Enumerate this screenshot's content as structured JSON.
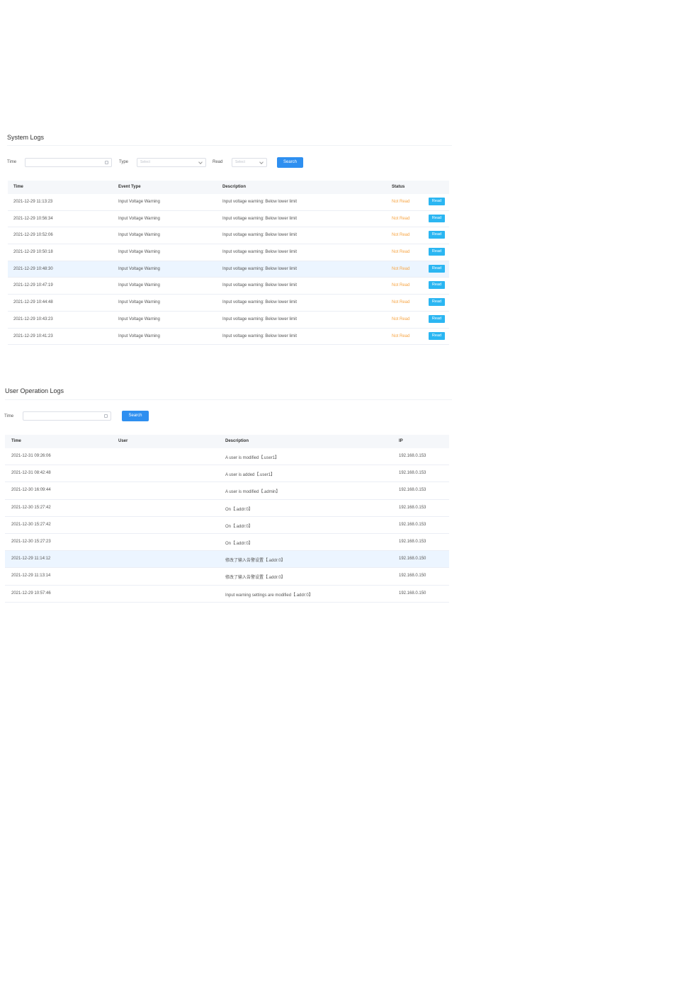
{
  "system_logs": {
    "title": "System Logs",
    "filters": {
      "time_label": "Time",
      "time_value": "",
      "type_label": "Type",
      "type_placeholder": "Select",
      "read_label": "Read",
      "read_placeholder": "Select",
      "search_label": "Search"
    },
    "columns": [
      "Time",
      "Event Type",
      "Description",
      "Status"
    ],
    "rows": [
      {
        "time": "2021-12-29 11:13:23",
        "event_type": "Input Voltage Warning",
        "description": "Input voltage warning:   Below lower limit",
        "status": "Not Read",
        "action": "Read"
      },
      {
        "time": "2021-12-29 10:56:34",
        "event_type": "Input Voltage Warning",
        "description": "Input voltage warning:   Below lower limit",
        "status": "Not Read",
        "action": "Read"
      },
      {
        "time": "2021-12-29 10:52:06",
        "event_type": "Input Voltage Warning",
        "description": "Input voltage warning:   Below lower limit",
        "status": "Not Read",
        "action": "Read"
      },
      {
        "time": "2021-12-29 10:50:18",
        "event_type": "Input Voltage Warning",
        "description": "Input voltage warning:   Below lower limit",
        "status": "Not Read",
        "action": "Read"
      },
      {
        "time": "2021-12-29 10:48:30",
        "event_type": "Input Voltage Warning",
        "description": "Input voltage warning:   Below lower limit",
        "status": "Not Read",
        "action": "Read"
      },
      {
        "time": "2021-12-29 10:47:19",
        "event_type": "Input Voltage Warning",
        "description": "Input voltage warning:   Below lower limit",
        "status": "Not Read",
        "action": "Read"
      },
      {
        "time": "2021-12-29 10:44:48",
        "event_type": "Input Voltage Warning",
        "description": "Input voltage warning:   Below lower limit",
        "status": "Not Read",
        "action": "Read"
      },
      {
        "time": "2021-12-29 10:43:23",
        "event_type": "Input Voltage Warning",
        "description": "Input voltage warning:   Below lower limit",
        "status": "Not Read",
        "action": "Read"
      },
      {
        "time": "2021-12-29 10:41:23",
        "event_type": "Input Voltage Warning",
        "description": "Input voltage warning:   Below lower limit",
        "status": "Not Read",
        "action": "Read"
      }
    ]
  },
  "user_logs": {
    "title": "User Operation Logs",
    "filters": {
      "time_label": "Time",
      "time_value": "",
      "search_label": "Search"
    },
    "columns": [
      "Time",
      "User",
      "Description",
      "IP"
    ],
    "rows": [
      {
        "time": "2021-12-31 09:26:06",
        "user": "",
        "description": "A user is modified【.user1】",
        "ip": "192.168.0.153"
      },
      {
        "time": "2021-12-31 08:42:48",
        "user": "",
        "description": "A user is added【.user1】",
        "ip": "192.168.0.153"
      },
      {
        "time": "2021-12-30 16:09:44",
        "user": "",
        "description": "A user is modified【.admin】",
        "ip": "192.168.0.153"
      },
      {
        "time": "2021-12-30 15:27:42",
        "user": "",
        "description": "On【.addr:0】",
        "ip": "192.168.0.153"
      },
      {
        "time": "2021-12-30 15:27:42",
        "user": "",
        "description": "On【.addr:0】",
        "ip": "192.168.0.153"
      },
      {
        "time": "2021-12-30 15:27:23",
        "user": "",
        "description": "On【.addr:0】",
        "ip": "192.168.0.153"
      },
      {
        "time": "2021-12-29 11:14:12",
        "user": "",
        "description": "修改了输入告警设置【.addr:0】",
        "ip": "192.168.0.150"
      },
      {
        "time": "2021-12-29 11:13:14",
        "user": "",
        "description": "修改了输入告警设置【.addr:0】",
        "ip": "192.168.0.150"
      },
      {
        "time": "2021-12-29 10:57:46",
        "user": "",
        "description": "Input warning settings are modified【.addr:0】",
        "ip": "192.168.0.150"
      }
    ]
  },
  "colors": {
    "primary": "#2e8ff0",
    "read_button": "#2bb6f2",
    "not_read_status": "#f7a442",
    "row_highlight": "#ecf5ff",
    "header_bg": "#f5f7fa"
  }
}
